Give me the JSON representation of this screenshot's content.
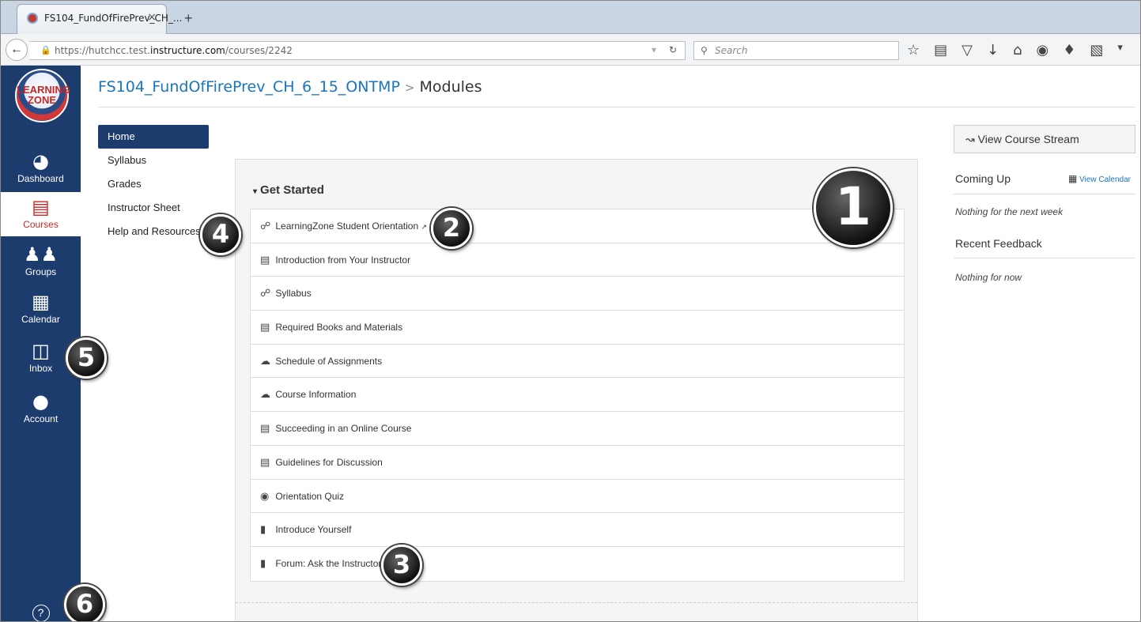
{
  "browser": {
    "tab_title": "FS104_FundOfFirePrev_CH_...",
    "tab_close": "×",
    "new_tab": "+",
    "url_prefix": "https://hutchcc.test.",
    "url_domain": "instructure.com",
    "url_path": "/courses/2242",
    "search_placeholder": "Search"
  },
  "global_nav": {
    "logo_text": "LEARNING ZONE",
    "items": [
      {
        "label": "Dashboard",
        "icon": "dashboard-icon"
      },
      {
        "label": "Courses",
        "icon": "courses-icon"
      },
      {
        "label": "Groups",
        "icon": "groups-icon"
      },
      {
        "label": "Calendar",
        "icon": "calendar-icon"
      },
      {
        "label": "Inbox",
        "icon": "inbox-icon"
      },
      {
        "label": "Account",
        "icon": "account-icon"
      }
    ],
    "help_icon": "help-icon"
  },
  "breadcrumb": {
    "course": "FS104_FundOfFirePrev_CH_6_15_ONTMP",
    "separator": ">",
    "current": "Modules"
  },
  "course_nav": [
    "Home",
    "Syllabus",
    "Grades",
    "Instructor Sheet",
    "Help and Resources"
  ],
  "module": {
    "title": "Get Started",
    "items": [
      {
        "label": "LearningZone Student Orientation",
        "icon": "link-icon",
        "external": true
      },
      {
        "label": "Introduction from Your Instructor",
        "icon": "page-icon"
      },
      {
        "label": "Syllabus",
        "icon": "link-icon"
      },
      {
        "label": "Required Books and Materials",
        "icon": "page-icon"
      },
      {
        "label": "Schedule of Assignments",
        "icon": "cloud-icon"
      },
      {
        "label": "Course Information",
        "icon": "cloud-icon"
      },
      {
        "label": "Succeeding in an Online Course",
        "icon": "page-icon"
      },
      {
        "label": "Guidelines for Discussion",
        "icon": "page-icon"
      },
      {
        "label": "Orientation Quiz",
        "icon": "quiz-icon"
      },
      {
        "label": "Introduce Yourself",
        "icon": "discussion-icon"
      },
      {
        "label": "Forum: Ask the Instructor",
        "icon": "discussion-icon"
      }
    ]
  },
  "sidebar": {
    "stream_button": "View Course Stream",
    "coming_up": "Coming Up",
    "view_calendar": "View Calendar",
    "coming_up_note": "Nothing for the next week",
    "recent_feedback": "Recent Feedback",
    "feedback_note": "Nothing for now"
  },
  "callouts": [
    "1",
    "2",
    "3",
    "4",
    "5",
    "6"
  ],
  "colors": {
    "nav_bg": "#1d3c6e",
    "link": "#1b75bb",
    "active_red": "#c62828"
  }
}
